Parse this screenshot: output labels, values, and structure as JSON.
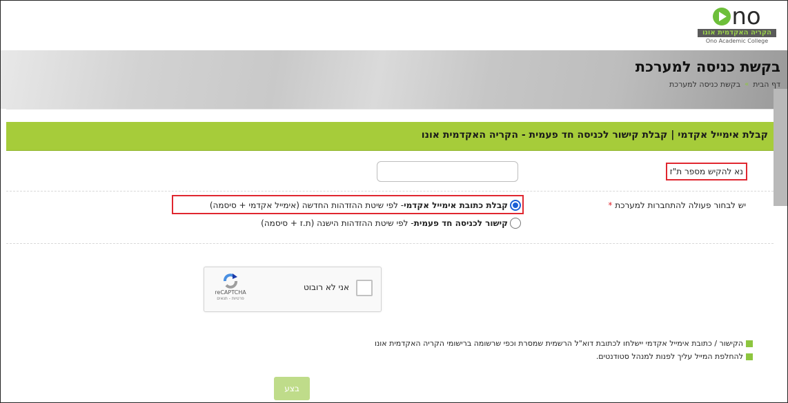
{
  "logo": {
    "mark_text": "no",
    "hebrew": "הקריה האקדמית אונו",
    "english": "Ono Academic College"
  },
  "hero": {
    "title": "בקשת כניסה למערכת",
    "breadcrumb": [
      "דף הבית",
      "בקשת כניסה למערכת"
    ],
    "breadcrumb_separator": "»"
  },
  "panel": {
    "title": "קבלת אימייל אקדמי | קבלת קישור לכניסה חד פעמית - הקריה האקדמית אונו"
  },
  "form": {
    "id_label": "נא להקיש מספר ת\"ז",
    "id_value": "",
    "action_label": "יש לבחור פעולה להתחברות למערכת",
    "required_mark": "*",
    "options": [
      {
        "bold": "קבלת כתובת אימייל אקדמי",
        "rest": " - לפי שיטת ההזדהות החדשה (אימייל אקדמי + סיסמה)",
        "selected": true
      },
      {
        "bold": "קישור לכניסה חד פעמית",
        "rest": " - לפי שיטת ההזדהות הישנה (ת.ז + סיסמה)",
        "selected": false
      }
    ]
  },
  "captcha": {
    "label": "אני לא רובוט",
    "brand": "reCAPTCHA",
    "terms": "פרטיות - תנאים"
  },
  "notes": [
    "הקישור / כתובת אימייל אקדמי יישלחו לכתובת דוא\"ל הרשמית שמסרת וכפי שרשומה ברישומי הקריה האקדמית אונו",
    "להחלפת המייל עליך לפנות למנהל סטודנטים."
  ],
  "submit_label": "בצע",
  "colors": {
    "accent_green": "#a6cc3a",
    "bullet_green": "#8dc63f",
    "highlight_red": "#e0262f",
    "radio_blue": "#1a5fd6"
  },
  "icons": {
    "logo": "ono-play-logo-icon",
    "captcha": "recaptcha-arrows-icon"
  }
}
